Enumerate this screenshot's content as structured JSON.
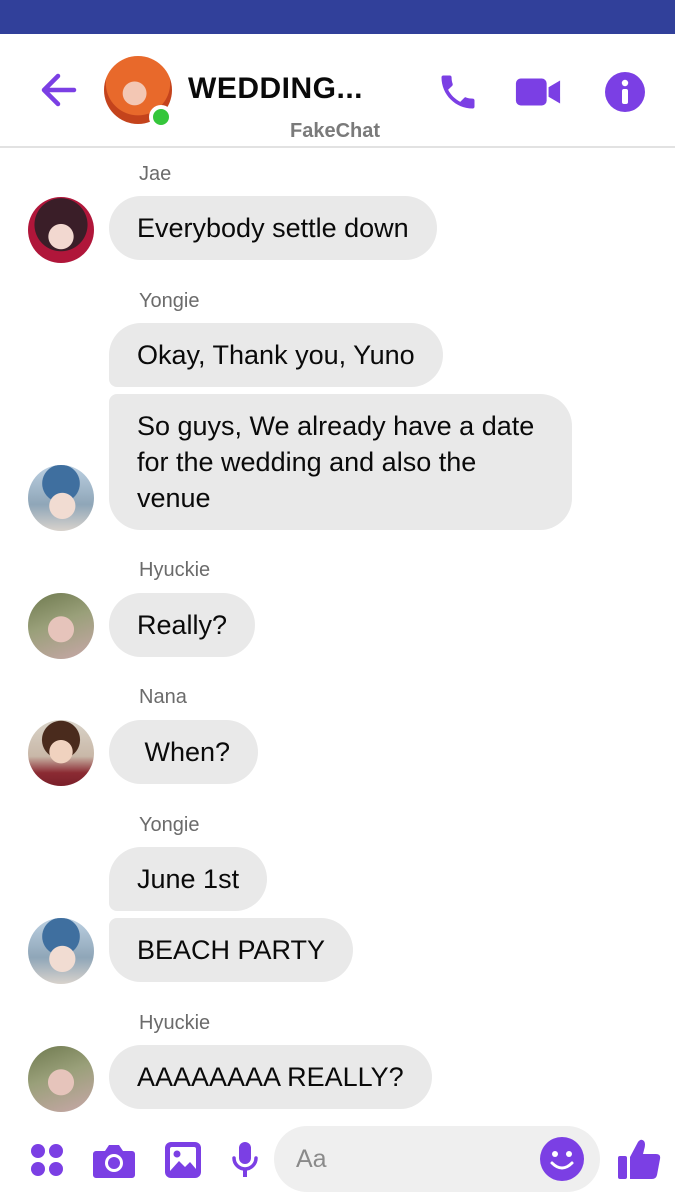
{
  "header": {
    "title": "WEDDING...",
    "subtitle": "FakeChat"
  },
  "colors": {
    "status_bar": "#31409a",
    "accent": "#7b3fe4",
    "bubble": "#e9e9e9",
    "online": "#35c63b"
  },
  "icons": {
    "back": "arrow-left-icon",
    "call": "phone-icon",
    "video": "video-camera-icon",
    "info": "info-icon",
    "apps": "four-dots-icon",
    "camera": "camera-icon",
    "gallery": "image-icon",
    "mic": "microphone-icon",
    "emoji": "smiley-icon",
    "like": "thumbs-up-icon"
  },
  "messages": [
    {
      "sender": "Jae",
      "text": "Everybody settle down"
    },
    {
      "sender": "Yongie",
      "text": "Okay, Thank you,  Yuno"
    },
    {
      "sender": "Yongie",
      "text": "So guys,  We already have a date for the wedding and also the venue"
    },
    {
      "sender": "Hyuckie",
      "text": "Really?"
    },
    {
      "sender": "Nana",
      "text": " When?"
    },
    {
      "sender": "Yongie",
      "text": "June 1st"
    },
    {
      "sender": "Yongie",
      "text": "BEACH PARTY"
    },
    {
      "sender": "Hyuckie",
      "text": "AAAAAAAA REALLY?"
    }
  ],
  "composer": {
    "placeholder": "Aa",
    "value": ""
  }
}
